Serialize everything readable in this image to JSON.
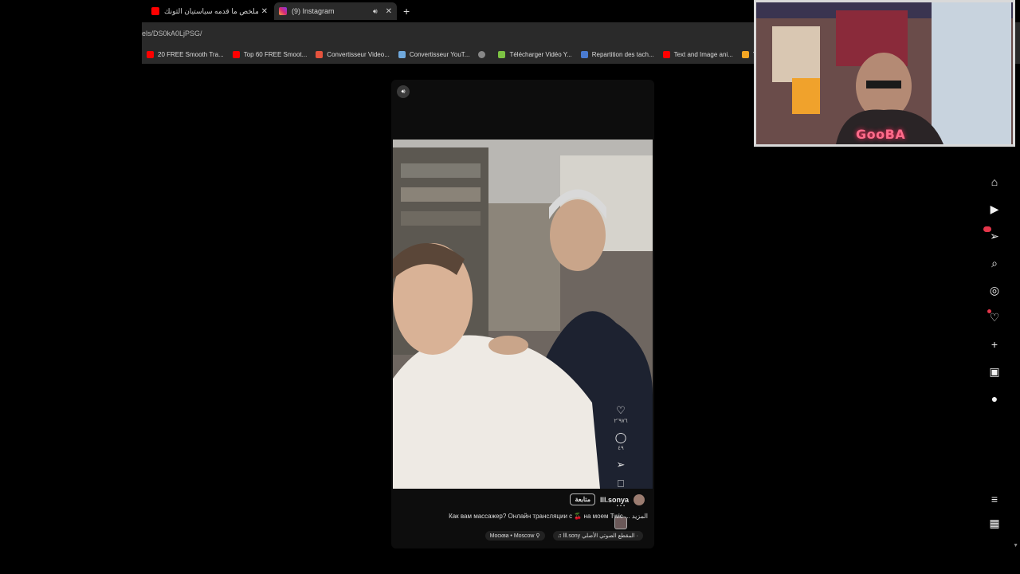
{
  "tabs": [
    {
      "title": "ملخص ما قدمه سياستيان الثونك...",
      "favicon_color": "#ff0000",
      "active": false
    },
    {
      "title": "(9) Instagram",
      "favicon_color": "#d62976",
      "active": true
    }
  ],
  "address": {
    "url": "els/DS0kA0LjPSG/"
  },
  "bookmarks": [
    {
      "label": "20 FREE Smooth Tra...",
      "icon_color": "#ff0000"
    },
    {
      "label": "Top 60 FREE Smoot...",
      "icon_color": "#ff0000"
    },
    {
      "label": "Convertisseur Video...",
      "icon_color": "#e5533d"
    },
    {
      "label": "Convertisseur YouT...",
      "icon_color": "#6fa8dc"
    },
    {
      "label": "",
      "icon_color": "#888888"
    },
    {
      "label": "Télécharger Vidéo Y...",
      "icon_color": "#7cc243"
    },
    {
      "label": "Repartition des tach...",
      "icon_color": "#4a7bd0"
    },
    {
      "label": "Text and Image ani...",
      "icon_color": "#ff0000"
    },
    {
      "label": "Yo",
      "icon_color": "#f5a623"
    }
  ],
  "reel": {
    "author": "lll.sonya",
    "follow_label": "متابعة",
    "caption": "Как вам массажер? Онлайн трансляции с 🍒 на моем Twic ... المزيد",
    "location": "Москва • Moscow ⚲",
    "audio": "♫ lll.sony المقطع الصوتي الأصلي ·",
    "likes": "٢٬٩٧٦",
    "comments": "٤٩"
  },
  "webcam": {
    "label": "GooBA"
  }
}
